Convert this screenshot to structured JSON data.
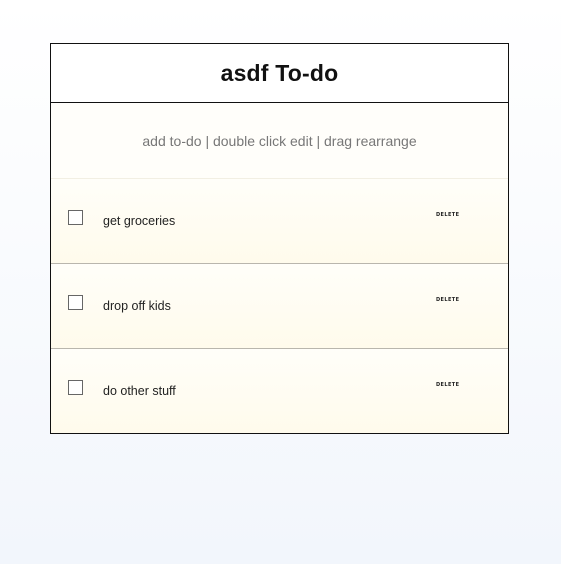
{
  "app": {
    "title": "asdf To-do"
  },
  "new_todo": {
    "placeholder": "add to-do | double click edit | drag rearrange",
    "value": ""
  },
  "todos": [
    {
      "text": "get groceries",
      "completed": false,
      "delete_label": "DELETE"
    },
    {
      "text": "drop off kids",
      "completed": false,
      "delete_label": "DELETE"
    },
    {
      "text": "do other stuff",
      "completed": false,
      "delete_label": "DELETE"
    }
  ]
}
